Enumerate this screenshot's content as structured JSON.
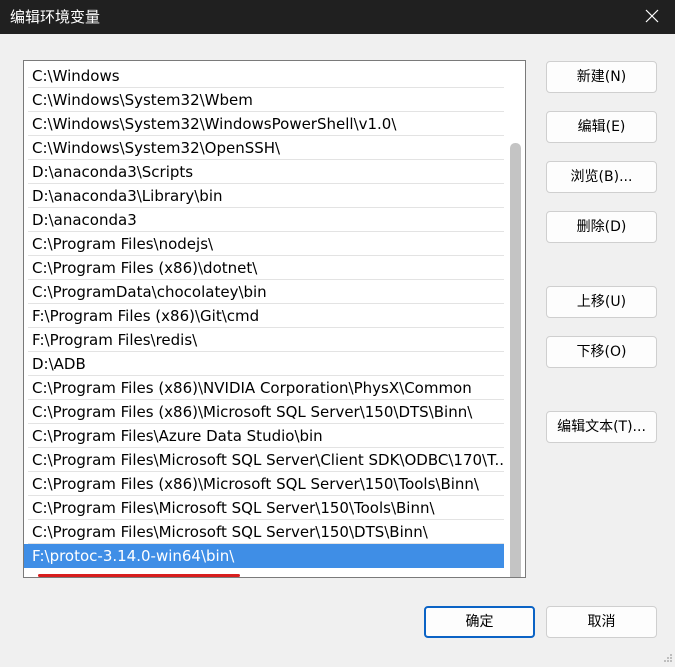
{
  "window": {
    "title": "编辑环境变量"
  },
  "icons": {
    "close": "close-icon",
    "resize": "resize-grip-icon"
  },
  "colors": {
    "selection": "#3f8ee6",
    "annotation_underline": "#d81e1e",
    "default_button_border": "#0b63c5"
  },
  "path_list": {
    "items": [
      "C:\\Windows",
      "C:\\Windows\\System32\\Wbem",
      "C:\\Windows\\System32\\WindowsPowerShell\\v1.0\\",
      "C:\\Windows\\System32\\OpenSSH\\",
      "D:\\anaconda3\\Scripts",
      "D:\\anaconda3\\Library\\bin",
      "D:\\anaconda3",
      "C:\\Program Files\\nodejs\\",
      "C:\\Program Files (x86)\\dotnet\\",
      "C:\\ProgramData\\chocolatey\\bin",
      "F:\\Program Files (x86)\\Git\\cmd",
      "F:\\Program Files\\redis\\",
      "D:\\ADB",
      "C:\\Program Files (x86)\\NVIDIA Corporation\\PhysX\\Common",
      "C:\\Program Files (x86)\\Microsoft SQL Server\\150\\DTS\\Binn\\",
      "C:\\Program Files\\Azure Data Studio\\bin",
      "C:\\Program Files\\Microsoft SQL Server\\Client SDK\\ODBC\\170\\T...",
      "C:\\Program Files (x86)\\Microsoft SQL Server\\150\\Tools\\Binn\\",
      "C:\\Program Files\\Microsoft SQL Server\\150\\Tools\\Binn\\",
      "C:\\Program Files\\Microsoft SQL Server\\150\\DTS\\Binn\\",
      "F:\\protoc-3.14.0-win64\\bin\\"
    ],
    "selected_index": 20
  },
  "buttons": {
    "new": "新建(N)",
    "edit": "编辑(E)",
    "browse": "浏览(B)...",
    "delete": "删除(D)",
    "move_up": "上移(U)",
    "move_down": "下移(O)",
    "edit_text": "编辑文本(T)...",
    "ok": "确定",
    "cancel": "取消"
  }
}
